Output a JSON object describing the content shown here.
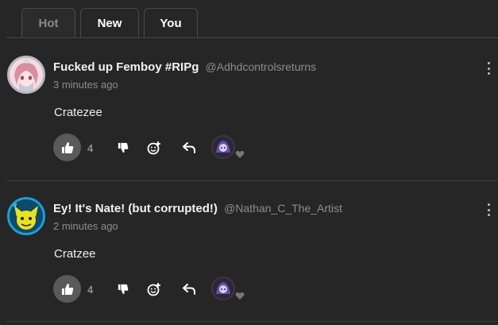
{
  "tabs": [
    {
      "label": "Hot",
      "active": true
    },
    {
      "label": "New",
      "active": false
    },
    {
      "label": "You",
      "active": false
    }
  ],
  "posts": [
    {
      "display_name": "Fucked up Femboy #RIPg",
      "handle": "@Adhdcontrolsreturns",
      "time": "3 minutes ago",
      "content": "Cratezee",
      "like_count": "4",
      "avatar_icon": "anime-avatar-icon"
    },
    {
      "display_name": "Ey! It's Nate! (but corrupted!)",
      "handle": "@Nathan_C_The_Artist",
      "time": "2 minutes ago",
      "content": "Cratzee",
      "like_count": "4",
      "avatar_icon": "character-avatar-icon"
    }
  ],
  "colors": {
    "background": "#262626",
    "like_button": "#5a5a5a",
    "secondary_text": "#8d8d8d",
    "post2_avatar_ring": "#1d9fd8"
  }
}
